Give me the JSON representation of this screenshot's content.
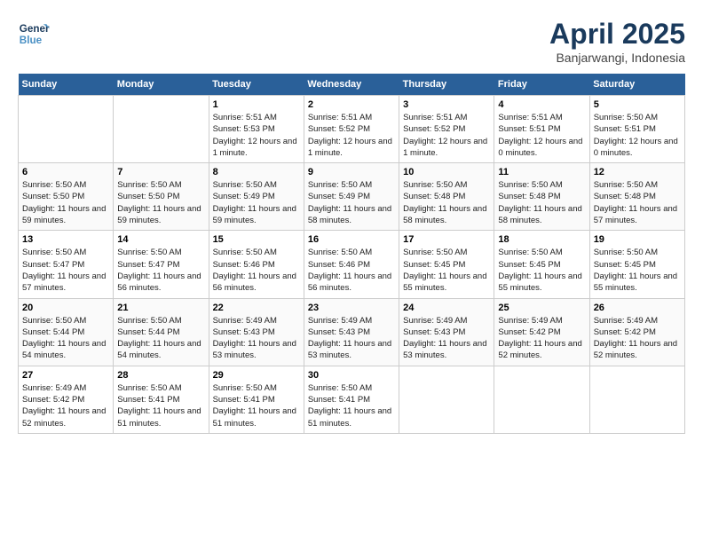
{
  "header": {
    "logo_line1": "General",
    "logo_line2": "Blue",
    "month_title": "April 2025",
    "subtitle": "Banjarwangi, Indonesia"
  },
  "weekdays": [
    "Sunday",
    "Monday",
    "Tuesday",
    "Wednesday",
    "Thursday",
    "Friday",
    "Saturday"
  ],
  "weeks": [
    [
      {
        "day": "",
        "empty": true
      },
      {
        "day": "",
        "empty": true
      },
      {
        "day": "1",
        "sunrise": "Sunrise: 5:51 AM",
        "sunset": "Sunset: 5:53 PM",
        "daylight": "Daylight: 12 hours and 1 minute."
      },
      {
        "day": "2",
        "sunrise": "Sunrise: 5:51 AM",
        "sunset": "Sunset: 5:52 PM",
        "daylight": "Daylight: 12 hours and 1 minute."
      },
      {
        "day": "3",
        "sunrise": "Sunrise: 5:51 AM",
        "sunset": "Sunset: 5:52 PM",
        "daylight": "Daylight: 12 hours and 1 minute."
      },
      {
        "day": "4",
        "sunrise": "Sunrise: 5:51 AM",
        "sunset": "Sunset: 5:51 PM",
        "daylight": "Daylight: 12 hours and 0 minutes."
      },
      {
        "day": "5",
        "sunrise": "Sunrise: 5:50 AM",
        "sunset": "Sunset: 5:51 PM",
        "daylight": "Daylight: 12 hours and 0 minutes."
      }
    ],
    [
      {
        "day": "6",
        "sunrise": "Sunrise: 5:50 AM",
        "sunset": "Sunset: 5:50 PM",
        "daylight": "Daylight: 11 hours and 59 minutes."
      },
      {
        "day": "7",
        "sunrise": "Sunrise: 5:50 AM",
        "sunset": "Sunset: 5:50 PM",
        "daylight": "Daylight: 11 hours and 59 minutes."
      },
      {
        "day": "8",
        "sunrise": "Sunrise: 5:50 AM",
        "sunset": "Sunset: 5:49 PM",
        "daylight": "Daylight: 11 hours and 59 minutes."
      },
      {
        "day": "9",
        "sunrise": "Sunrise: 5:50 AM",
        "sunset": "Sunset: 5:49 PM",
        "daylight": "Daylight: 11 hours and 58 minutes."
      },
      {
        "day": "10",
        "sunrise": "Sunrise: 5:50 AM",
        "sunset": "Sunset: 5:48 PM",
        "daylight": "Daylight: 11 hours and 58 minutes."
      },
      {
        "day": "11",
        "sunrise": "Sunrise: 5:50 AM",
        "sunset": "Sunset: 5:48 PM",
        "daylight": "Daylight: 11 hours and 58 minutes."
      },
      {
        "day": "12",
        "sunrise": "Sunrise: 5:50 AM",
        "sunset": "Sunset: 5:48 PM",
        "daylight": "Daylight: 11 hours and 57 minutes."
      }
    ],
    [
      {
        "day": "13",
        "sunrise": "Sunrise: 5:50 AM",
        "sunset": "Sunset: 5:47 PM",
        "daylight": "Daylight: 11 hours and 57 minutes."
      },
      {
        "day": "14",
        "sunrise": "Sunrise: 5:50 AM",
        "sunset": "Sunset: 5:47 PM",
        "daylight": "Daylight: 11 hours and 56 minutes."
      },
      {
        "day": "15",
        "sunrise": "Sunrise: 5:50 AM",
        "sunset": "Sunset: 5:46 PM",
        "daylight": "Daylight: 11 hours and 56 minutes."
      },
      {
        "day": "16",
        "sunrise": "Sunrise: 5:50 AM",
        "sunset": "Sunset: 5:46 PM",
        "daylight": "Daylight: 11 hours and 56 minutes."
      },
      {
        "day": "17",
        "sunrise": "Sunrise: 5:50 AM",
        "sunset": "Sunset: 5:45 PM",
        "daylight": "Daylight: 11 hours and 55 minutes."
      },
      {
        "day": "18",
        "sunrise": "Sunrise: 5:50 AM",
        "sunset": "Sunset: 5:45 PM",
        "daylight": "Daylight: 11 hours and 55 minutes."
      },
      {
        "day": "19",
        "sunrise": "Sunrise: 5:50 AM",
        "sunset": "Sunset: 5:45 PM",
        "daylight": "Daylight: 11 hours and 55 minutes."
      }
    ],
    [
      {
        "day": "20",
        "sunrise": "Sunrise: 5:50 AM",
        "sunset": "Sunset: 5:44 PM",
        "daylight": "Daylight: 11 hours and 54 minutes."
      },
      {
        "day": "21",
        "sunrise": "Sunrise: 5:50 AM",
        "sunset": "Sunset: 5:44 PM",
        "daylight": "Daylight: 11 hours and 54 minutes."
      },
      {
        "day": "22",
        "sunrise": "Sunrise: 5:49 AM",
        "sunset": "Sunset: 5:43 PM",
        "daylight": "Daylight: 11 hours and 53 minutes."
      },
      {
        "day": "23",
        "sunrise": "Sunrise: 5:49 AM",
        "sunset": "Sunset: 5:43 PM",
        "daylight": "Daylight: 11 hours and 53 minutes."
      },
      {
        "day": "24",
        "sunrise": "Sunrise: 5:49 AM",
        "sunset": "Sunset: 5:43 PM",
        "daylight": "Daylight: 11 hours and 53 minutes."
      },
      {
        "day": "25",
        "sunrise": "Sunrise: 5:49 AM",
        "sunset": "Sunset: 5:42 PM",
        "daylight": "Daylight: 11 hours and 52 minutes."
      },
      {
        "day": "26",
        "sunrise": "Sunrise: 5:49 AM",
        "sunset": "Sunset: 5:42 PM",
        "daylight": "Daylight: 11 hours and 52 minutes."
      }
    ],
    [
      {
        "day": "27",
        "sunrise": "Sunrise: 5:49 AM",
        "sunset": "Sunset: 5:42 PM",
        "daylight": "Daylight: 11 hours and 52 minutes."
      },
      {
        "day": "28",
        "sunrise": "Sunrise: 5:50 AM",
        "sunset": "Sunset: 5:41 PM",
        "daylight": "Daylight: 11 hours and 51 minutes."
      },
      {
        "day": "29",
        "sunrise": "Sunrise: 5:50 AM",
        "sunset": "Sunset: 5:41 PM",
        "daylight": "Daylight: 11 hours and 51 minutes."
      },
      {
        "day": "30",
        "sunrise": "Sunrise: 5:50 AM",
        "sunset": "Sunset: 5:41 PM",
        "daylight": "Daylight: 11 hours and 51 minutes."
      },
      {
        "day": "",
        "empty": true
      },
      {
        "day": "",
        "empty": true
      },
      {
        "day": "",
        "empty": true
      }
    ]
  ]
}
